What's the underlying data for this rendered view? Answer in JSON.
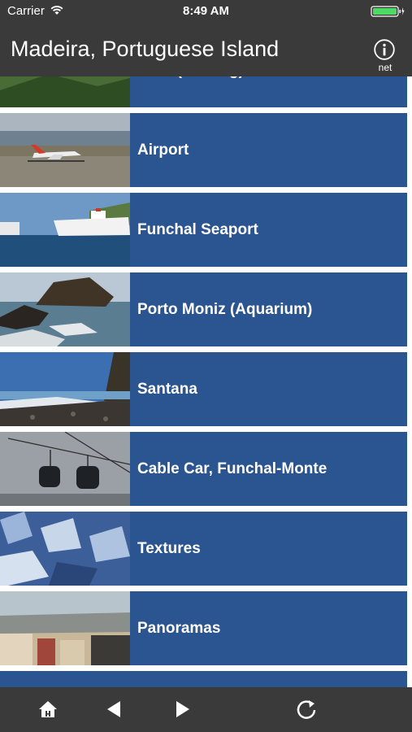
{
  "status_bar": {
    "carrier": "Carrier",
    "time": "8:49 AM",
    "battery_color": "#4cd964"
  },
  "nav": {
    "title": "Madeira, Portuguese Island",
    "info_label": "net",
    "info_icon": "info-icon"
  },
  "list": {
    "accent_color": "#2b5590",
    "items": [
      {
        "label": "Faial (walking)",
        "thumb": "green-hills"
      },
      {
        "label": "Airport",
        "thumb": "airplane"
      },
      {
        "label": "Funchal Seaport",
        "thumb": "cruise-ship"
      },
      {
        "label": "Porto Moniz (Aquarium)",
        "thumb": "rock-sea"
      },
      {
        "label": "Santana",
        "thumb": "pebble-beach"
      },
      {
        "label": "Cable Car, Funchal-Monte",
        "thumb": "cable-car"
      },
      {
        "label": "Textures",
        "thumb": "texture"
      },
      {
        "label": "Panoramas",
        "thumb": "sunset-town"
      }
    ]
  },
  "toolbar": {
    "buttons": [
      "home-icon",
      "back-arrow-icon",
      "forward-arrow-icon",
      "reload-icon"
    ]
  }
}
